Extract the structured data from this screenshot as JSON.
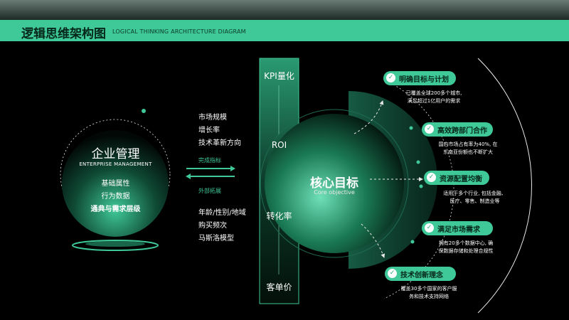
{
  "header": {
    "title": "逻辑思维架构图",
    "subtitle": "LOGICAL THINKING ARCHITECTURE DIAGRAM"
  },
  "enterprise": {
    "title": "企业管理",
    "subtitle": "ENTERPRISE MANAGEMENT",
    "items": [
      "基础属性",
      "行为数据",
      "通典与需求层级"
    ]
  },
  "mid_top": [
    "市场规模",
    "增长率",
    "技术革新方向"
  ],
  "arrow_top_label": "完成指标",
  "arrow_bottom_label": "外部拓展",
  "mid_bottom": [
    "年龄/性别/地域",
    "购买频次",
    "马斯洛模型"
  ],
  "metrics": [
    "KPI量化",
    "ROI",
    "转化率",
    "客单价"
  ],
  "core": {
    "title": "核心目标",
    "subtitle": "Core objective"
  },
  "objectives": [
    {
      "label": "明确目标与计划",
      "desc": [
        "已覆盖全球200多个城市,",
        "满足超过1亿用户的需求"
      ]
    },
    {
      "label": "高效跨部门合作",
      "desc": [
        "国内市场占有率为40%, 在",
        "东南亚份额也不断扩大"
      ]
    },
    {
      "label": "资源配置均衡",
      "desc": [
        "适用于多个行业, 包括金融、",
        "医疗、零售、制造业等"
      ]
    },
    {
      "label": "满足市场需求",
      "desc": [
        "拥有20多个数据中心, 确",
        "保数据存储和处理合规性"
      ]
    },
    {
      "label": "技术创新理念",
      "desc": [
        "覆盖30多个国家的客户服",
        "务和技术支持网络"
      ]
    }
  ],
  "colors": {
    "accent": "#3fc898",
    "background": "#000000"
  },
  "icons": {
    "check": "check-circle-icon"
  }
}
